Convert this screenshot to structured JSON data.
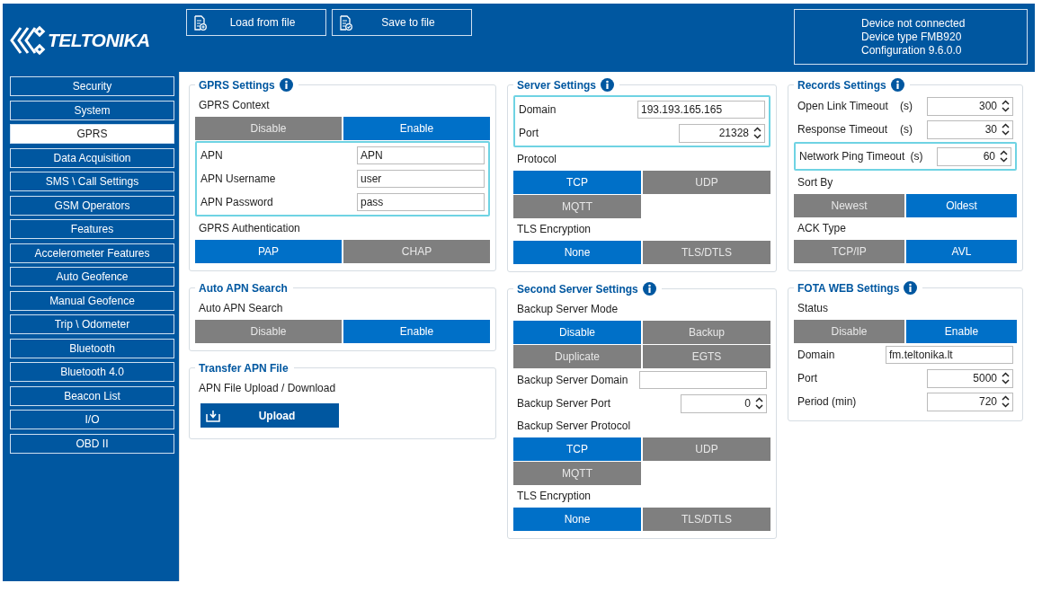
{
  "header": {
    "logo": "TELTONIKA",
    "buttons": [
      {
        "label": "Load from file"
      },
      {
        "label": "Save to file"
      }
    ],
    "device_info": [
      "Device not connected",
      "Device type FMB920",
      "Configuration 9.6.0.0"
    ]
  },
  "sidebar": {
    "items": [
      {
        "label": "Security",
        "selected": false
      },
      {
        "label": "System",
        "selected": false
      },
      {
        "label": "GPRS",
        "selected": true
      },
      {
        "label": "Data Acquisition",
        "selected": false
      },
      {
        "label": "SMS \\ Call Settings",
        "selected": false
      },
      {
        "label": "GSM Operators",
        "selected": false
      },
      {
        "label": "Features",
        "selected": false
      },
      {
        "label": "Accelerometer Features",
        "selected": false
      },
      {
        "label": "Auto Geofence",
        "selected": false
      },
      {
        "label": "Manual Geofence",
        "selected": false
      },
      {
        "label": "Trip \\ Odometer",
        "selected": false
      },
      {
        "label": "Bluetooth",
        "selected": false
      },
      {
        "label": "Bluetooth 4.0",
        "selected": false
      },
      {
        "label": "Beacon List",
        "selected": false
      },
      {
        "label": "I/O",
        "selected": false
      },
      {
        "label": "OBD II",
        "selected": false
      }
    ]
  },
  "columns": [
    [
      {
        "title": "GPRS Settings",
        "info": true,
        "rows": [
          {
            "kind": "label",
            "text": "GPRS Context"
          },
          {
            "kind": "options",
            "options": [
              {
                "label": "Disable",
                "selected": false
              },
              {
                "label": "Enable",
                "selected": true
              }
            ]
          },
          {
            "kind": "group",
            "highlighted": true,
            "rows": [
              {
                "kind": "text",
                "label": "APN",
                "value": "APN"
              },
              {
                "kind": "text",
                "label": "APN Username",
                "value": "user"
              },
              {
                "kind": "text",
                "label": "APN Password",
                "value": "pass"
              }
            ]
          },
          {
            "kind": "label",
            "text": "GPRS Authentication"
          },
          {
            "kind": "options",
            "options": [
              {
                "label": "PAP",
                "selected": true
              },
              {
                "label": "CHAP",
                "selected": false
              }
            ]
          }
        ]
      },
      {
        "title": "Auto APN Search",
        "rows": [
          {
            "kind": "label",
            "text": "Auto APN Search"
          },
          {
            "kind": "options",
            "options": [
              {
                "label": "Disable",
                "selected": false
              },
              {
                "label": "Enable",
                "selected": true
              }
            ]
          }
        ]
      },
      {
        "title": "Transfer APN File",
        "rows": [
          {
            "kind": "label",
            "text": "APN File Upload / Download"
          },
          {
            "kind": "upload",
            "label": "Upload"
          }
        ]
      }
    ],
    [
      {
        "title": "Server Settings",
        "info": true,
        "rows": [
          {
            "kind": "group",
            "highlighted": true,
            "rows": [
              {
                "kind": "text",
                "label": "Domain",
                "value": "193.193.165.165"
              },
              {
                "kind": "spin",
                "label": "Port",
                "value": "21328"
              }
            ]
          },
          {
            "kind": "label",
            "text": "Protocol"
          },
          {
            "kind": "options",
            "options": [
              {
                "label": "TCP",
                "selected": true
              },
              {
                "label": "UDP",
                "selected": false
              },
              {
                "label": "MQTT",
                "selected": false
              }
            ]
          },
          {
            "kind": "label",
            "text": "TLS Encryption"
          },
          {
            "kind": "options",
            "options": [
              {
                "label": "None",
                "selected": true
              },
              {
                "label": "TLS/DTLS",
                "selected": false
              }
            ]
          }
        ]
      },
      {
        "title": "Second Server Settings",
        "info": true,
        "rows": [
          {
            "kind": "label",
            "text": "Backup Server Mode"
          },
          {
            "kind": "options",
            "options": [
              {
                "label": "Disable",
                "selected": true
              },
              {
                "label": "Backup",
                "selected": false
              },
              {
                "label": "Duplicate",
                "selected": false
              },
              {
                "label": "EGTS",
                "selected": false
              }
            ]
          },
          {
            "kind": "text",
            "label": "Backup Server Domain"
          },
          {
            "kind": "spin",
            "label": "Backup Server Port",
            "value": "0"
          },
          {
            "kind": "label",
            "text": "Backup Server Protocol"
          },
          {
            "kind": "options",
            "options": [
              {
                "label": "TCP",
                "selected": true
              },
              {
                "label": "UDP",
                "selected": false
              },
              {
                "label": "MQTT",
                "selected": false
              }
            ]
          },
          {
            "kind": "label",
            "text": "TLS Encryption"
          },
          {
            "kind": "options",
            "options": [
              {
                "label": "None",
                "selected": true
              },
              {
                "label": "TLS/DTLS",
                "selected": false
              }
            ]
          }
        ]
      }
    ],
    [
      {
        "title": "Records Settings",
        "info": true,
        "rows": [
          {
            "kind": "spin",
            "label": "Open Link Timeout",
            "unit": "(s)",
            "value": "300"
          },
          {
            "kind": "spin",
            "label": "Response Timeout",
            "unit": "(s)",
            "value": "30"
          },
          {
            "kind": "group",
            "highlighted": true,
            "rows": [
              {
                "kind": "spin",
                "label": "Network Ping Timeout",
                "unit": "(s)",
                "value": "60"
              }
            ]
          },
          {
            "kind": "label",
            "text": "Sort By"
          },
          {
            "kind": "options",
            "options": [
              {
                "label": "Newest",
                "selected": false
              },
              {
                "label": "Oldest",
                "selected": true
              }
            ]
          },
          {
            "kind": "label",
            "text": "ACK Type"
          },
          {
            "kind": "options",
            "options": [
              {
                "label": "TCP/IP",
                "selected": false
              },
              {
                "label": "AVL",
                "selected": true
              }
            ]
          }
        ]
      },
      {
        "title": "FOTA WEB Settings",
        "info": true,
        "rows": [
          {
            "kind": "label",
            "text": "Status"
          },
          {
            "kind": "options",
            "options": [
              {
                "label": "Disable",
                "selected": false
              },
              {
                "label": "Enable",
                "selected": true
              }
            ]
          },
          {
            "kind": "text",
            "label": "Domain",
            "value": "fm.teltonika.lt"
          },
          {
            "kind": "spin",
            "label": "Port",
            "value": "5000"
          },
          {
            "kind": "spin",
            "label": "Period (min)",
            "value": "720"
          }
        ]
      }
    ]
  ]
}
